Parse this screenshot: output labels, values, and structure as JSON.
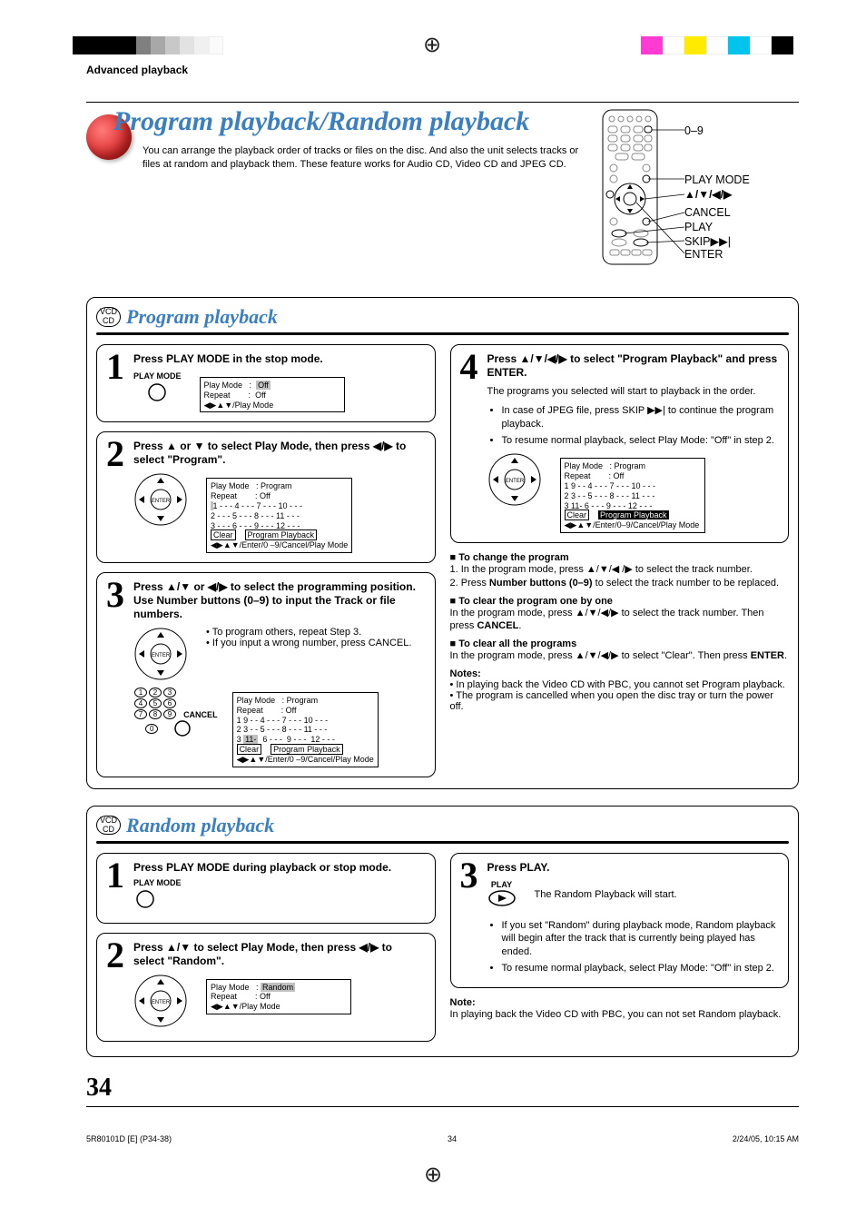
{
  "header": {
    "section_label": "Advanced playback",
    "title": "Program playback/Random playback",
    "intro": "You can arrange the playback order of tracks or files on the disc. And also the unit selects tracks or files at random and playback them. These feature works for Audio CD, Video CD and JPEG CD."
  },
  "remote": {
    "label_numbers": "0–9",
    "label_playmode": "PLAY MODE",
    "label_arrows": "▲/▼/◀/▶",
    "label_cancel": "CANCEL",
    "label_play": "PLAY",
    "label_skip": "SKIP▶▶|",
    "label_enter": "ENTER"
  },
  "program": {
    "disc_labels": "VCD\nCD",
    "title": "Program playback",
    "steps": {
      "s1": {
        "num": "1",
        "head": "Press PLAY MODE in the stop mode.",
        "button_label": "PLAY MODE",
        "osd_l1": "Play Mode",
        "osd_l1v": "Off",
        "osd_l2": "Repeat",
        "osd_l2v": "Off",
        "osd_foot": "◀▶▲▼/Play Mode"
      },
      "s2": {
        "num": "2",
        "head": "Press ▲ or ▼ to select Play Mode, then press ◀/▶ to select \"Program\".",
        "osd_l1": "Play Mode",
        "osd_l1v": "Program",
        "osd_l2": "Repeat",
        "osd_l2v": "Off",
        "grid_r1": "1 - - -   4 - - -   7 - - -   10 - - -",
        "grid_r2": "2 - - -   5 - - -   8 - - -   11 - - -",
        "grid_r3": "3 - - -   6 - - -   9 - - -   12 - - -",
        "btn_clear": "Clear",
        "btn_pp": "Program Playback",
        "osd_foot": "◀▶▲▼/Enter/0 –9/Cancel/Play Mode"
      },
      "s3": {
        "num": "3",
        "head": "Press ▲/▼ or ◀/▶ to select the programming position. Use Number buttons (0–9) to input the Track or file numbers.",
        "bullet1": "To program others, repeat Step 3.",
        "bullet2": "If you input a wrong number, press CANCEL.",
        "numpad_labels": [
          "1",
          "2",
          "3",
          "4",
          "5",
          "6",
          "7",
          "8",
          "9",
          "0"
        ],
        "cancel_label": "CANCEL",
        "osd_l1": "Play Mode",
        "osd_l1v": "Program",
        "osd_l2": "Repeat",
        "osd_l2v": "Off",
        "grid_r1": "1 9 - -   4 - - -   7 - - -   10 - - -",
        "grid_r2": "2 3 - -   5 - - -   8 - - -   11 - - -",
        "grid_r3": "3 11-    6 - - -   9 - - -   12 - - -",
        "hl_cell": "11-",
        "btn_clear": "Clear",
        "btn_pp": "Program Playback",
        "osd_foot": "◀▶▲▼/Enter/0 –9/Cancel/Play Mode"
      },
      "s4": {
        "num": "4",
        "head": "Press ▲/▼/◀/▶ to select \"Program Playback\" and press ENTER.",
        "body": "The programs you selected will start to playback in the order.",
        "bullet1": "In case of JPEG file, press SKIP ▶▶| to continue the program playback.",
        "bullet2": "To resume normal playback, select Play Mode: \"Off\" in step 2.",
        "osd_l1": "Play Mode",
        "osd_l1v": "Program",
        "osd_l2": "Repeat",
        "osd_l2v": "Off",
        "grid_r1": "1 9 - -   4 - - -   7 - - -   10 - - -",
        "grid_r2": "2 3 - -   5 - - -   8 - - -   11 - - -",
        "grid_r3": "3 11-    6 - - -   9 - - -   12 - - -",
        "btn_clear": "Clear",
        "btn_pp": "Program Playback",
        "osd_foot": "◀▶▲▼/Enter/0–9/Cancel/Play Mode"
      }
    },
    "extra": {
      "h1": "To change the program",
      "p1a": "1. In the program mode, press ▲/▼/◀ /▶ to select the track number.",
      "p1b": "2. Press Number buttons (0–9) to select the track number to be replaced.",
      "h2": "To clear the program one by one",
      "p2": "In the program mode, press ▲/▼/◀/▶ to select the track number. Then press CANCEL.",
      "h3": "To clear all the programs",
      "p3": "In the program mode, press ▲/▼/◀/▶ to select \"Clear\". Then press ENTER.",
      "notes_title": "Notes:",
      "note1": "In playing back the Video CD with PBC, you cannot set Program playback.",
      "note2": "The program is cancelled when you open the disc tray or turn the power off."
    }
  },
  "random": {
    "disc_labels": "VCD\nCD",
    "title": "Random playback",
    "steps": {
      "s1": {
        "num": "1",
        "head": "Press PLAY MODE during playback or stop mode.",
        "button_label": "PLAY MODE"
      },
      "s2": {
        "num": "2",
        "head": "Press ▲/▼ to select Play Mode, then press ◀/▶ to select \"Random\".",
        "osd_l1": "Play Mode",
        "osd_l1v": "Random",
        "osd_l2": "Repeat",
        "osd_l2v": "Off",
        "osd_foot": "◀▶▲▼/Play Mode"
      },
      "s3": {
        "num": "3",
        "head": "Press PLAY.",
        "button_label": "PLAY",
        "body": "The Random Playback will start.",
        "bullet1": "If you set \"Random\" during playback mode, Random playback will begin after the track that is currently being played has ended.",
        "bullet2": "To resume normal playback, select Play Mode: \"Off\" in step 2."
      }
    },
    "note_title": "Note:",
    "note_body": "In playing back the Video CD with PBC, you can not set Random playback."
  },
  "footer": {
    "page": "34",
    "left": "5R80101D [E] (P34-38)",
    "mid": "34",
    "right": "2/24/05, 10:15 AM"
  }
}
